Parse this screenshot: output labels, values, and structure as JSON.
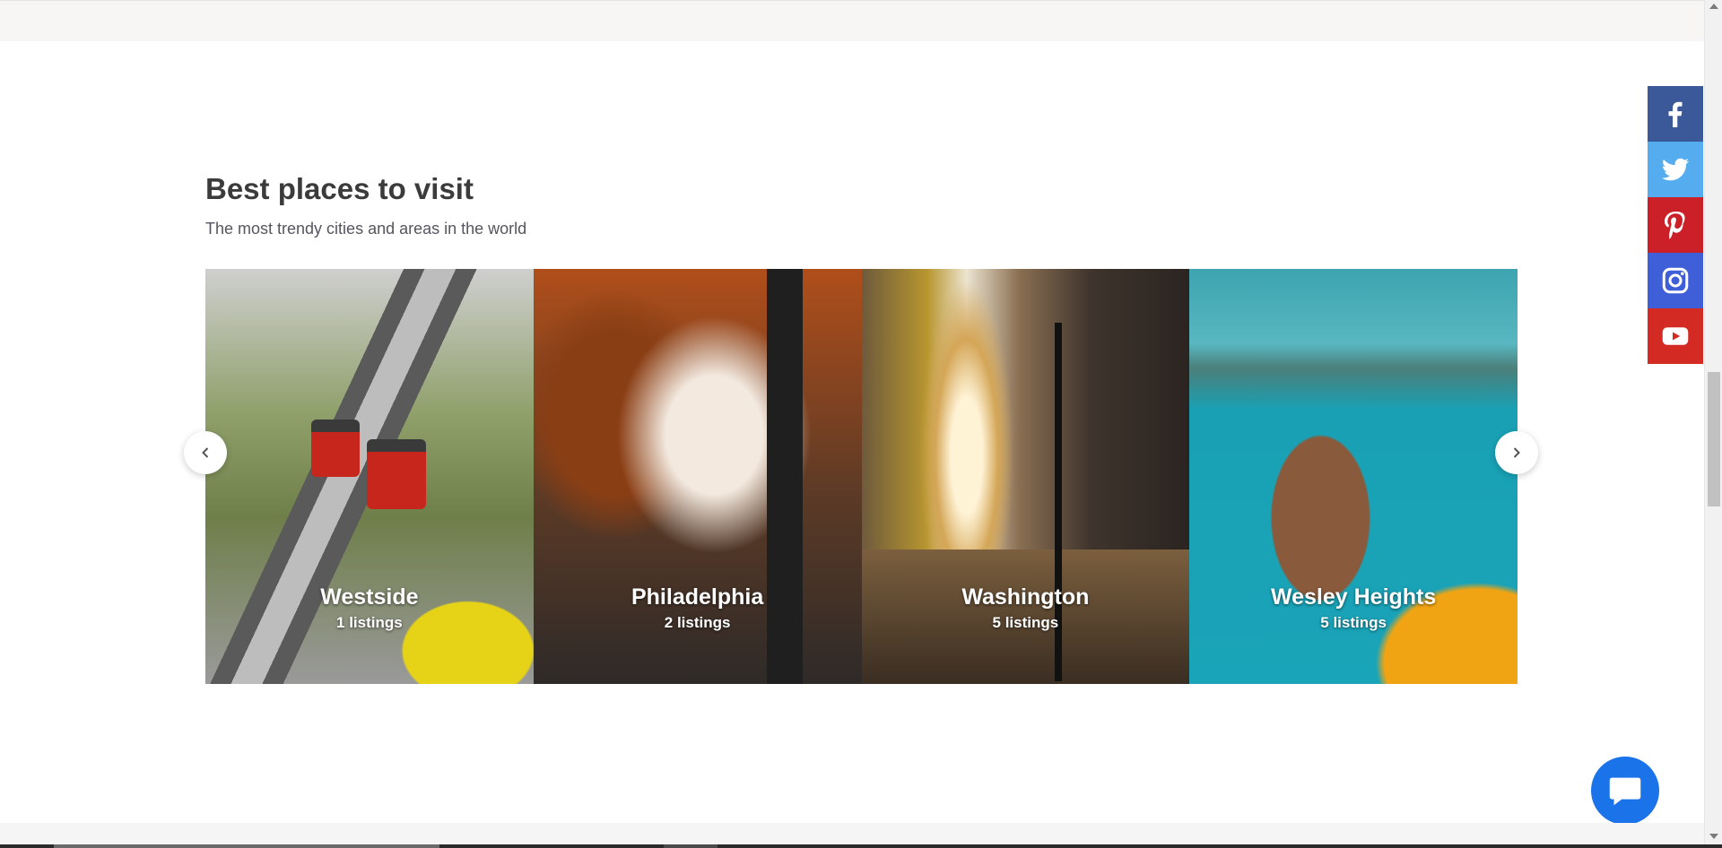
{
  "section": {
    "title": "Best places to visit",
    "subtitle": "The most trendy cities and areas in the world"
  },
  "places": [
    {
      "name": "Westside",
      "listings": "1 listings"
    },
    {
      "name": "Philadelphia",
      "listings": "2 listings"
    },
    {
      "name": "Washington",
      "listings": "5 listings"
    },
    {
      "name": "Wesley Heights",
      "listings": "5 listings"
    }
  ],
  "icons": {
    "prev": "chevron-left-icon",
    "next": "chevron-right-icon",
    "chat": "chat-bubble-icon"
  },
  "social": [
    {
      "name": "facebook",
      "color": "#3b5998"
    },
    {
      "name": "twitter",
      "color": "#55acee"
    },
    {
      "name": "pinterest",
      "color": "#cb2027"
    },
    {
      "name": "instagram",
      "color": "#3f5fd8"
    },
    {
      "name": "youtube",
      "color": "#d42a24"
    }
  ],
  "colors": {
    "chat": "#1a73e8"
  }
}
